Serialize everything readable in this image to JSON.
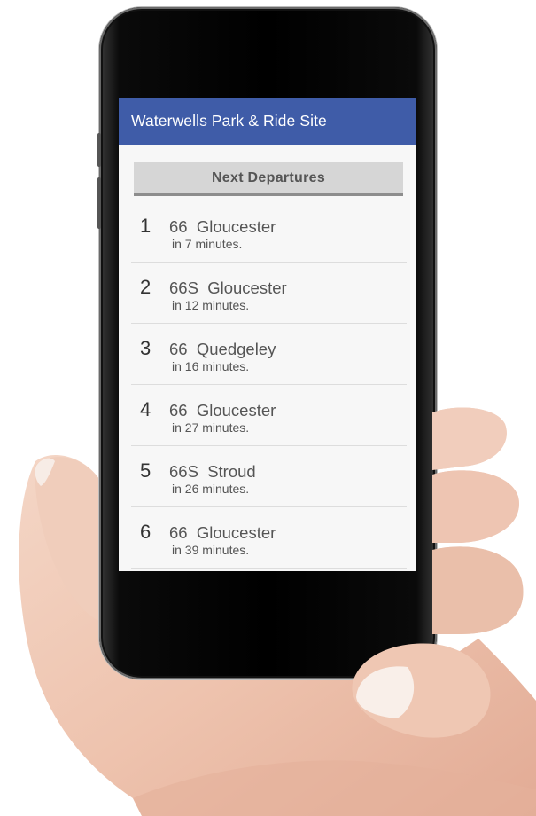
{
  "app": {
    "title": "Waterwells Park & Ride Site",
    "accent_color": "#3f5ca8"
  },
  "departures": {
    "header_label": "Next Departures",
    "items": [
      {
        "rank": "1",
        "route": "66  Gloucester",
        "eta": "in 7 minutes."
      },
      {
        "rank": "2",
        "route": "66S  Gloucester",
        "eta": "in 12 minutes."
      },
      {
        "rank": "3",
        "route": "66  Quedgeley",
        "eta": "in 16 minutes."
      },
      {
        "rank": "4",
        "route": "66  Gloucester",
        "eta": "in 27 minutes."
      },
      {
        "rank": "5",
        "route": "66S  Stroud",
        "eta": "in 26 minutes."
      },
      {
        "rank": "6",
        "route": "66  Gloucester",
        "eta": "in 39 minutes."
      }
    ]
  }
}
